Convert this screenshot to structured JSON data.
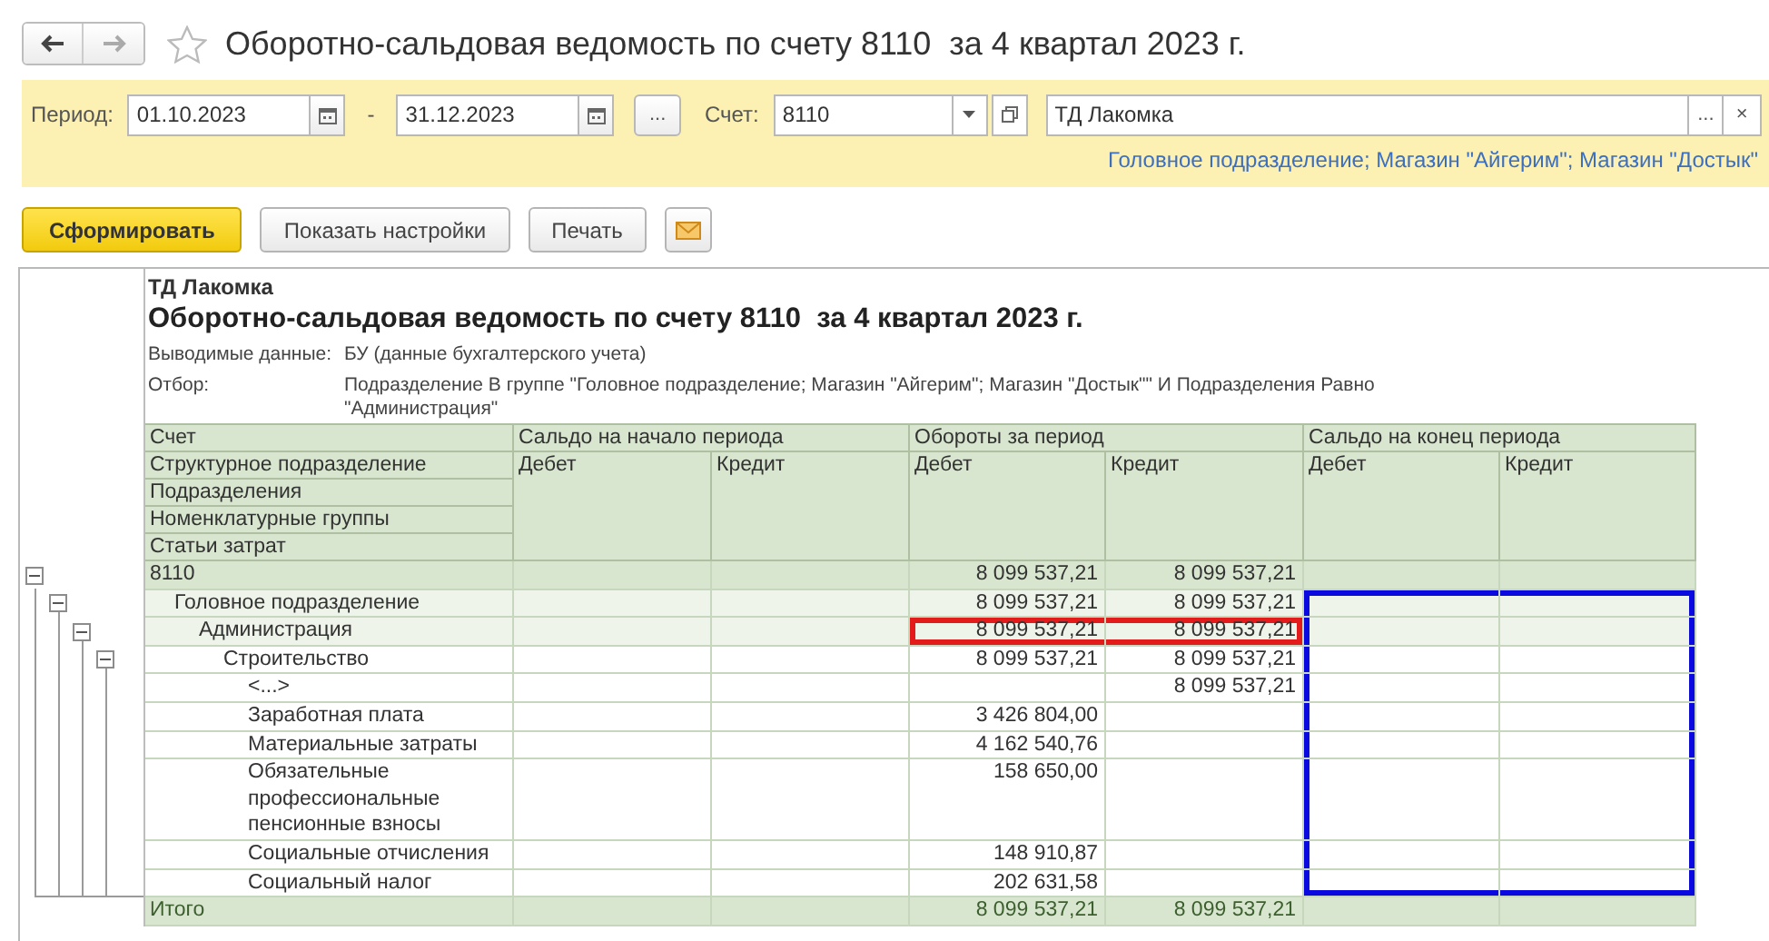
{
  "window": {
    "title": "Оборотно-сальдовая ведомость по счету 8110  за 4 квартал 2023 г."
  },
  "params": {
    "period_label": "Период:",
    "date_from": "01.10.2023",
    "separator": "-",
    "date_to": "31.12.2023",
    "period_button": "...",
    "account_label": "Счет:",
    "account": "8110",
    "organization": "ТД Лакомка",
    "org_select_button": "...",
    "org_clear_button": "×",
    "departments_link": "Головное подразделение; Магазин \"Айгерим\"; Магазин \"Достык\""
  },
  "actions": [
    {
      "kind": "primary",
      "label": "Сформировать"
    },
    {
      "kind": "default",
      "label": "Показать настройки"
    },
    {
      "kind": "default",
      "label": "Печать"
    },
    {
      "kind": "mail"
    }
  ],
  "report": {
    "company": "ТД Лакомка",
    "title": "Оборотно-сальдовая ведомость по счету 8110  за 4 квартал 2023 г.",
    "info": [
      {
        "label": "Выводимые данные:",
        "value": "БУ (данные бухгалтерского учета)"
      },
      {
        "label": "Отбор:",
        "value": "Подразделение В группе \"Головное подразделение; Магазин \"Айгерим\"; Магазин \"Достык\"\" И Подразделения Равно \"Администрация\""
      }
    ],
    "row_headers": [
      "Счет",
      "Структурное подразделение",
      "Подразделения",
      "Номенклатурные группы",
      "Статьи затрат"
    ],
    "column_groups": [
      {
        "label": "Сальдо на начало периода",
        "columns": [
          "Дебет",
          "Кредит"
        ]
      },
      {
        "label": "Обороты за период",
        "columns": [
          "Дебет",
          "Кредит"
        ]
      },
      {
        "label": "Сальдо на конец периода",
        "columns": [
          "Дебет",
          "Кредит"
        ]
      }
    ],
    "rows": [
      {
        "label": "8110",
        "turnover_debit": "8 099 537,21",
        "turnover_credit": "8 099 537,21",
        "expanded": true,
        "marked_turnover": false,
        "marked_closing": false,
        "children": [
          {
            "label": "Головное подразделение",
            "turnover_debit": "8 099 537,21",
            "turnover_credit": "8 099 537,21",
            "expanded": true,
            "marked_turnover": false,
            "marked_closing": true,
            "children": [
              {
                "label": "Администрация",
                "turnover_debit": "8 099 537,21",
                "turnover_credit": "8 099 537,21",
                "expanded": true,
                "marked_turnover": true,
                "marked_closing": true,
                "children": [
                  {
                    "label": "Строительство",
                    "turnover_debit": "8 099 537,21",
                    "turnover_credit": "8 099 537,21",
                    "expanded": true,
                    "marked_turnover": false,
                    "marked_closing": true,
                    "children": [
                      {
                        "label": "<...>",
                        "turnover_credit": "8 099 537,21",
                        "marked_turnover": false,
                        "marked_closing": true
                      },
                      {
                        "label": "Заработная плата",
                        "turnover_debit": "3 426 804,00",
                        "marked_turnover": false,
                        "marked_closing": true
                      },
                      {
                        "label": "Материальные затраты",
                        "turnover_debit": "4 162 540,76",
                        "marked_turnover": false,
                        "marked_closing": true
                      },
                      {
                        "label": "Обязательные профессиональные пенсионные взносы",
                        "turnover_debit": "158 650,00",
                        "marked_turnover": false,
                        "marked_closing": true
                      },
                      {
                        "label": "Социальные отчисления",
                        "turnover_debit": "148 910,87",
                        "marked_turnover": false,
                        "marked_closing": true
                      },
                      {
                        "label": "Социальный налог",
                        "turnover_debit": "202 631,58",
                        "marked_turnover": false,
                        "marked_closing": true
                      }
                    ]
                  }
                ]
              }
            ]
          }
        ]
      }
    ],
    "total": {
      "label": "Итого",
      "turnover_debit": "8 099 537,21",
      "turnover_credit": "8 099 537,21"
    }
  }
}
